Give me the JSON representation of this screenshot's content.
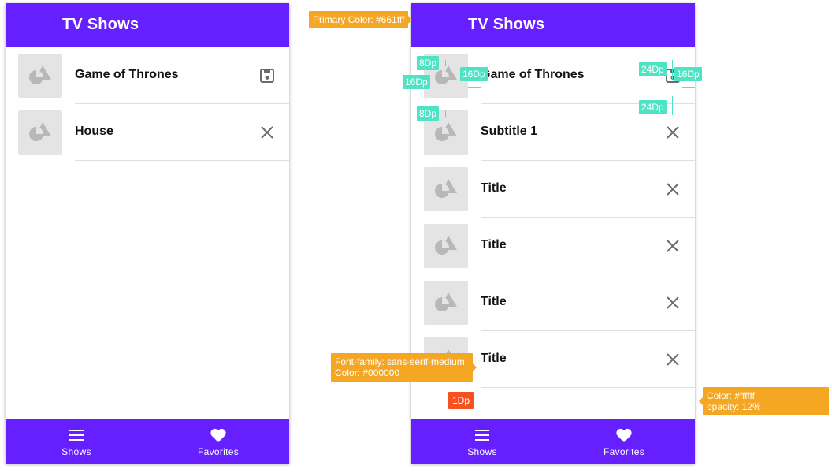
{
  "colors": {
    "primary": "#661fff",
    "thumbnail": "#e4e4e4",
    "annotation": "#f5a623",
    "spacing_tag": "#4ee3c5",
    "divider_tag": "#f5521f"
  },
  "left_screen": {
    "app_bar": {
      "title": "TV Shows"
    },
    "list": [
      {
        "title": "Game of Thrones",
        "action_icon": "save-icon"
      },
      {
        "title": "House",
        "action_icon": "close-icon"
      }
    ],
    "bottom_nav": [
      {
        "label": "Shows",
        "icon": "menu-icon"
      },
      {
        "label": "Favorites",
        "icon": "heart-icon"
      }
    ]
  },
  "right_screen": {
    "app_bar": {
      "title": "TV Shows"
    },
    "list": [
      {
        "title": "Game of Thrones",
        "action_icon": "save-icon"
      },
      {
        "title": "Subtitle 1",
        "action_icon": "close-icon"
      },
      {
        "title": "Title",
        "action_icon": "close-icon"
      },
      {
        "title": "Title",
        "action_icon": "close-icon"
      },
      {
        "title": "Title",
        "action_icon": "close-icon"
      },
      {
        "title": "Title",
        "action_icon": "close-icon"
      }
    ],
    "bottom_nav": [
      {
        "label": "Shows",
        "icon": "menu-icon"
      },
      {
        "label": "Favorites",
        "icon": "heart-icon"
      }
    ]
  },
  "annotations": {
    "primary_color": "Primary Color: #661fff",
    "font_line1": "Font-family: sans-serif-medium",
    "font_line2": "Color: #000000",
    "divider_height": "1Dp",
    "divider_color_line1": "Color: #ffffff",
    "divider_color_line2": "opacity: 12%",
    "spacing": {
      "thumb_top": "8Dp",
      "thumb_left": "16Dp",
      "thumb_bottom": "8Dp",
      "thumb_text_gap": "16Dp",
      "icon_top": "24Dp",
      "icon_right": "16Dp",
      "icon_bottom": "24Dp"
    }
  }
}
